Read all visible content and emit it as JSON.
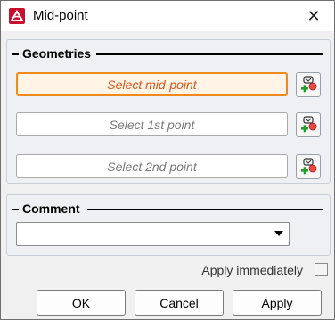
{
  "window": {
    "title": "Mid-point",
    "icon": "app-logo-icon",
    "close_icon": "close-icon"
  },
  "geometries": {
    "header": "Geometries",
    "fields": [
      {
        "placeholder": "Select mid-point",
        "active": true
      },
      {
        "placeholder": "Select 1st point",
        "active": false
      },
      {
        "placeholder": "Select 2nd point",
        "active": false
      }
    ],
    "pick_icon": "pick-point-icon",
    "accent_color": "#f08a1c"
  },
  "comment": {
    "header": "Comment",
    "value": ""
  },
  "apply_immediately": {
    "label": "Apply immediately",
    "checked": false
  },
  "buttons": {
    "ok": "OK",
    "cancel": "Cancel",
    "apply": "Apply"
  }
}
